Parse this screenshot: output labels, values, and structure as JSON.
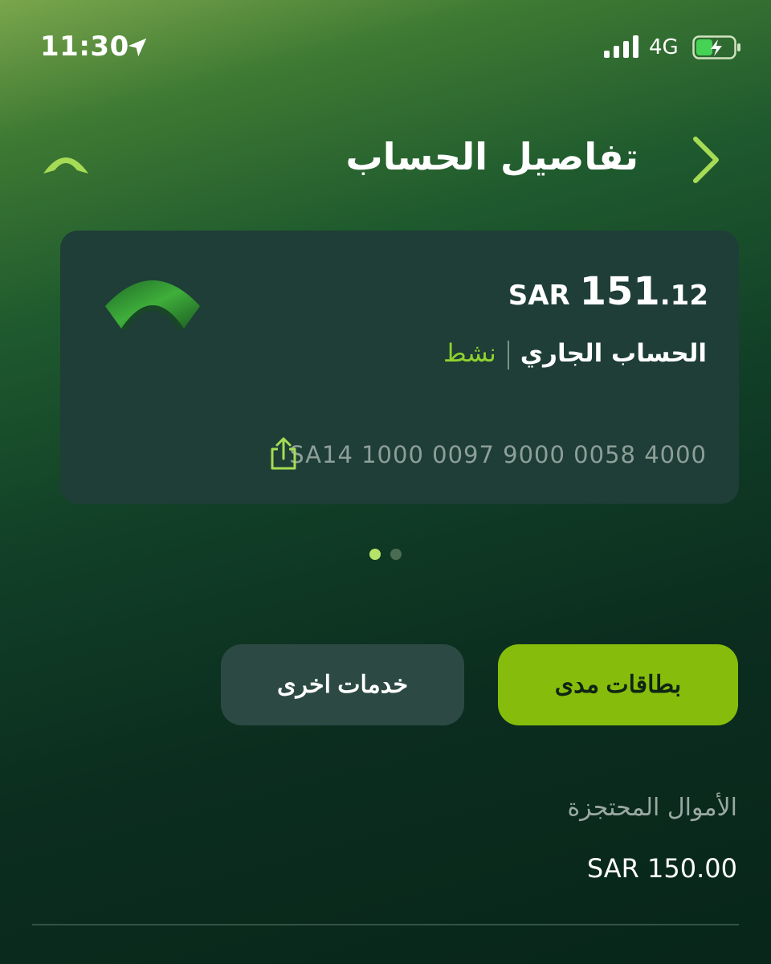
{
  "status_bar": {
    "time": "11:30",
    "network": "4G",
    "icons": [
      "location-arrow-icon",
      "signal-bars-icon",
      "battery-charging-icon"
    ]
  },
  "header": {
    "title": "تفاصيل الحساب",
    "icons": [
      "bank-logo-icon",
      "chevron-right-icon"
    ]
  },
  "account_card": {
    "currency": "SAR",
    "balance_whole": "151",
    "balance_decimal": ".12",
    "account_name": "الحساب الجاري",
    "status": "نشط",
    "iban": "SA14 1000 0097 9000 0058 4000",
    "icons": [
      "bank-logo-icon",
      "share-icon"
    ]
  },
  "pager": {
    "total": 2,
    "active": 1
  },
  "actions": {
    "mada_cards": "بطاقات مدى",
    "other_services": "خدمات اخرى"
  },
  "reserved_funds": {
    "label": "الأموال المحتجزة",
    "value": "SAR 150.00"
  },
  "colors": {
    "accent": "#86bd0c",
    "status_active": "#8fd22e",
    "card_bg": "#1e3e37",
    "secondary_button": "#2c4a43"
  }
}
